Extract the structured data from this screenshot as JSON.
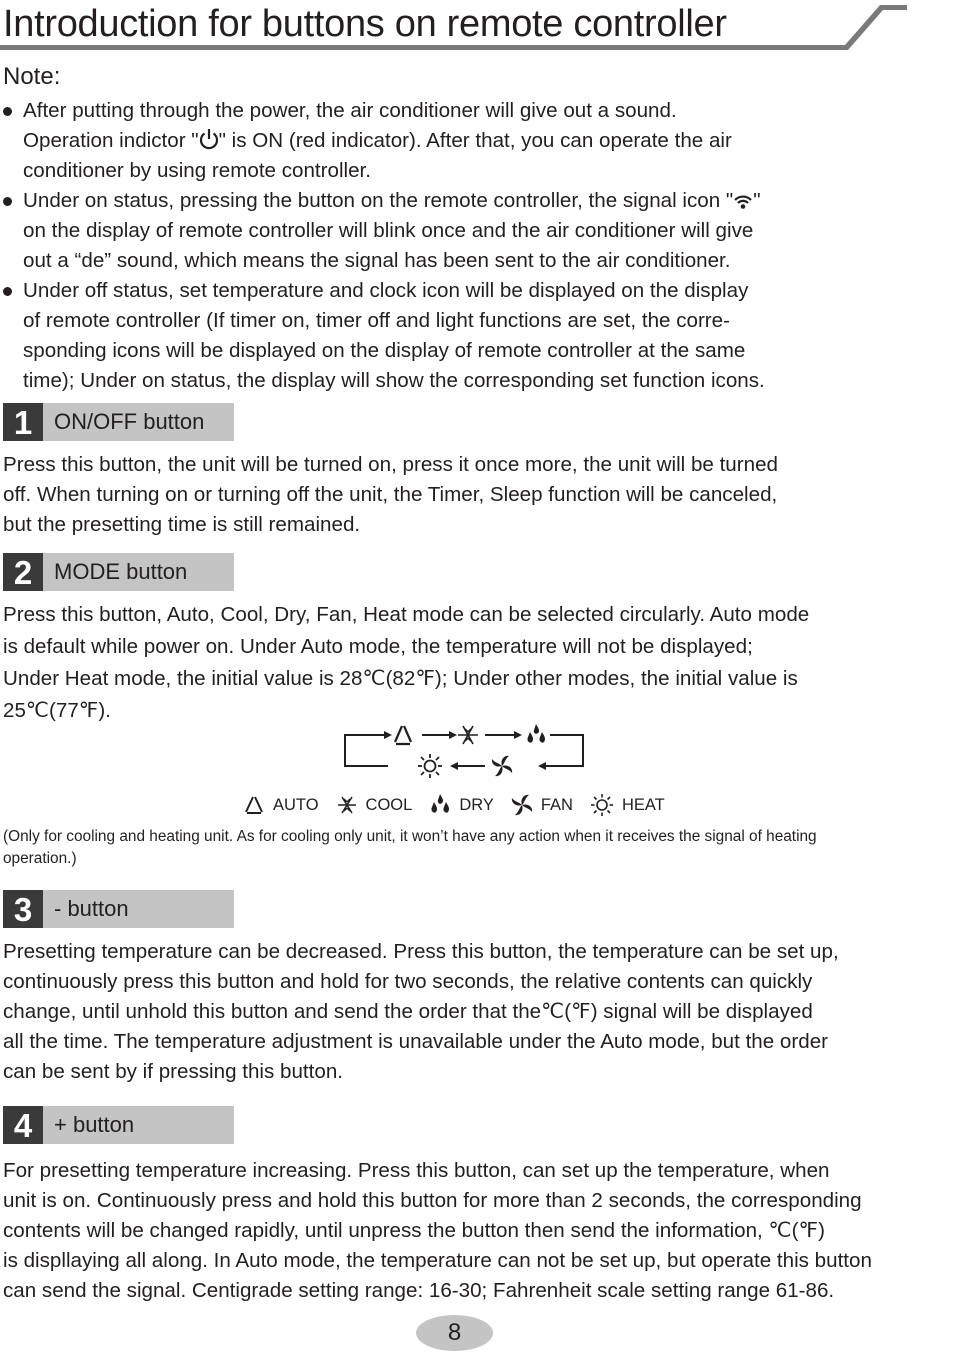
{
  "header": {
    "title": "Introduction for buttons on remote controller"
  },
  "note": {
    "heading": "Note:",
    "bullets": [
      {
        "lines": [
          "After putting through the power, the air conditioner will give out a sound.",
          [
            "Operation indictor \"",
            "\" is ON (red indicator). After that, you can operate the air"
          ],
          "conditioner by using remote controller."
        ],
        "icon": "power-icon"
      },
      {
        "lines": [
          [
            "Under on status, pressing the button on the remote controller, the signal icon \"",
            "\""
          ],
          "on the display of remote controller will blink once and the air conditioner will give",
          "out a “de” sound, which means the signal has been sent to the air conditioner."
        ],
        "icon": "signal-icon"
      },
      {
        "lines": [
          "Under off status, set temperature and clock icon will be displayed on the display",
          "of remote controller (If timer on, timer off and light functions are set, the corre-",
          "sponding icons will be displayed on the display of remote controller at the same",
          "time); Under on status, the display will show the corresponding set function icons."
        ]
      }
    ]
  },
  "sections": [
    {
      "number": "1",
      "label": "ON/OFF button",
      "lines": [
        "Press this button, the unit will be turned on, press it once more, the unit will be turned",
        "off. When turning on or turning off the unit, the Timer, Sleep function will be canceled,",
        "but the presetting time is still remained."
      ]
    },
    {
      "number": "2",
      "label": "MODE button",
      "lines": [
        "Press this button, Auto, Cool, Dry, Fan, Heat mode can be selected circularly. Auto mode",
        "is default while power on. Under Auto mode, the temperature will not be displayed;",
        "Under Heat mode, the initial value is 28℃(82℉); Under other modes, the initial value is",
        "25℃(77℉)."
      ],
      "mode_cycle": [
        "AUTO",
        "COOL",
        "DRY",
        "FAN",
        "HEAT"
      ],
      "legend": [
        {
          "icon": "auto-mode-icon",
          "label": "AUTO"
        },
        {
          "icon": "cool-mode-icon",
          "label": "COOL"
        },
        {
          "icon": "dry-mode-icon",
          "label": "DRY"
        },
        {
          "icon": "fan-mode-icon",
          "label": "FAN"
        },
        {
          "icon": "heat-mode-icon",
          "label": "HEAT"
        }
      ],
      "note_lines": [
        "(Only for cooling and heating unit. As for cooling only unit, it won’t have any action when it receives the signal of heating",
        "operation.)"
      ]
    },
    {
      "number": "3",
      "label": "- button",
      "lines": [
        "Presetting temperature can be decreased. Press this button, the temperature can be set up,",
        "continuously press this button and hold for two seconds, the relative contents can quickly",
        "change, until unhold this button and send the order that the℃(℉) signal will be displayed",
        "all the time. The temperature adjustment is unavailable under the Auto mode, but the order",
        "can be sent by if pressing this button."
      ]
    },
    {
      "number": "4",
      "label": "+ button",
      "lines": [
        "For presetting temperature increasing. Press this button, can set up the temperature, when",
        "unit is on. Continuously press and hold this button for more than 2 seconds, the corresponding",
        "contents will be changed rapidly, until unpress the button then send the information, ℃(℉)",
        "is displlaying all along. In Auto mode, the temperature can not be set up, but operate this button",
        "can send the signal. Centigrade setting range: 16-30; Fahrenheit scale setting range 61-86."
      ]
    }
  ],
  "footer": {
    "page_number": "8"
  },
  "colors": {
    "text": "#231f20",
    "section_number_bg": "#3a3a3a",
    "section_label_bg": "#c4c4c4",
    "title_rule": "#7a7a7a",
    "page_badge": "#c4c4c4"
  }
}
